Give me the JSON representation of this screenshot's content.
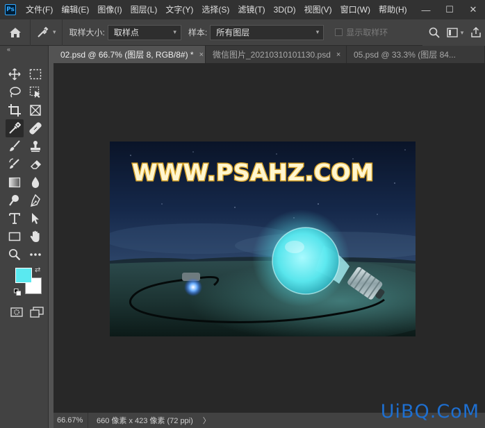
{
  "app": {
    "logo": "Ps"
  },
  "menu": [
    "文件(F)",
    "编辑(E)",
    "图像(I)",
    "图层(L)",
    "文字(Y)",
    "选择(S)",
    "滤镜(T)",
    "3D(D)",
    "视图(V)",
    "窗口(W)",
    "帮助(H)"
  ],
  "window_controls": {
    "minimize": "—",
    "restore": "☐",
    "close": "✕"
  },
  "options": {
    "sample_size_label": "取样大小:",
    "sample_size_value": "取样点",
    "sample_label": "样本:",
    "sample_value": "所有图层",
    "show_ring_label": "显示取样环"
  },
  "tabs": [
    {
      "label": "02.psd @ 66.7% (图层 8, RGB/8#) *",
      "close": "×"
    },
    {
      "label": "微信图片_20210310101130.psd",
      "close": "×"
    },
    {
      "label": "05.psd @ 33.3% (图层 84...",
      "close": ""
    }
  ],
  "canvas": {
    "headline": "WWW.PSAHZ.COM"
  },
  "colors": {
    "foreground": "#5ae9f0",
    "background": "#ffffff",
    "accent": "#31a8ff"
  },
  "status": {
    "zoom": "66.67%",
    "info": "660 像素 x 423 像素 (72 ppi)",
    "arrow": "〉"
  },
  "watermark": "UiBQ.CoM"
}
